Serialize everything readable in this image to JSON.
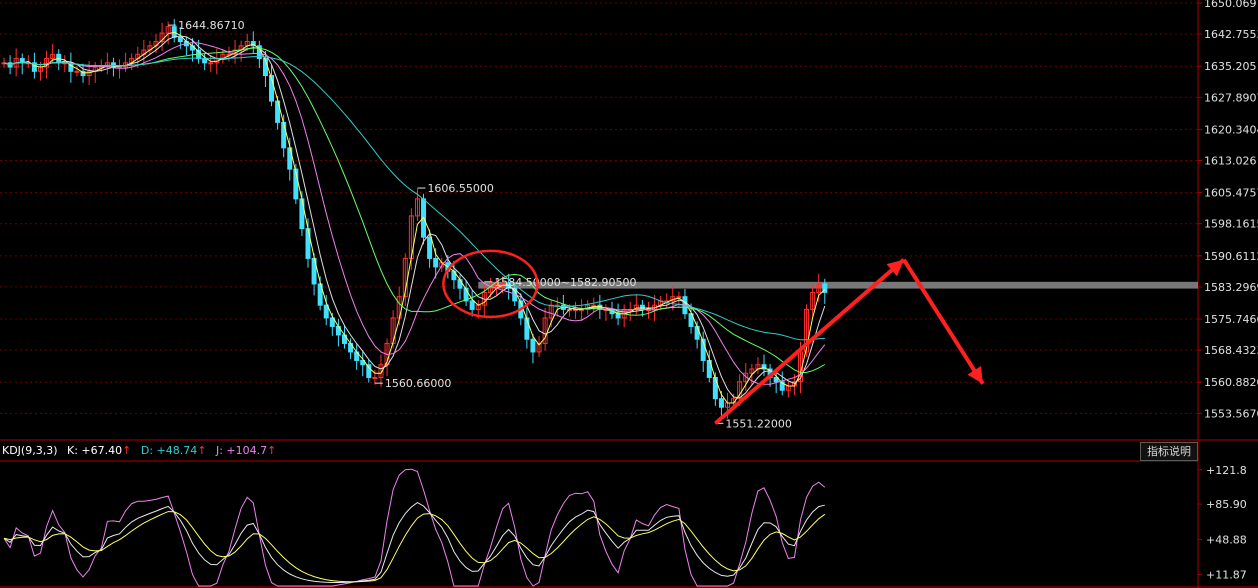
{
  "chart_data": [
    {
      "type": "line",
      "subtype": "candlestick-with-moving-averages",
      "ylim": [
        1548,
        1650.069
      ],
      "grid": true,
      "y_ticks": [
        {
          "label": "1650.069",
          "value": 1650.069
        },
        {
          "label": "1642.7553",
          "value": 1642.7553
        },
        {
          "label": "1635.205",
          "value": 1635.205
        },
        {
          "label": "1627.8907",
          "value": 1627.8907
        },
        {
          "label": "1620.3404",
          "value": 1620.3404
        },
        {
          "label": "1613.026",
          "value": 1613.026
        },
        {
          "label": "1605.4757",
          "value": 1605.4757
        },
        {
          "label": "1598.1615",
          "value": 1598.1615
        },
        {
          "label": "1590.6112",
          "value": 1590.6112
        },
        {
          "label": "1583.2969",
          "value": 1583.2969
        },
        {
          "label": "1575.7466",
          "value": 1575.7466
        },
        {
          "label": "1568.4323",
          "value": 1568.4323
        },
        {
          "label": "1560.8820",
          "value": 1560.882
        },
        {
          "label": "1553.5670",
          "value": 1553.567
        }
      ],
      "close_series": [
        1636,
        1635,
        1637,
        1636,
        1636,
        1634,
        1635,
        1637,
        1638,
        1636,
        1636,
        1634,
        1634,
        1633,
        1634,
        1635,
        1635,
        1636,
        1635,
        1635,
        1636,
        1637,
        1638,
        1639,
        1640,
        1641,
        1643,
        1644.5,
        1642,
        1641,
        1640,
        1639,
        1637,
        1636,
        1636,
        1637,
        1638,
        1638,
        1639,
        1640,
        1641,
        1640,
        1637,
        1633,
        1627,
        1622,
        1616,
        1611,
        1604,
        1597,
        1590,
        1584,
        1579,
        1576,
        1574,
        1572,
        1570,
        1568,
        1566,
        1565,
        1562,
        1562,
        1565,
        1570,
        1576,
        1581,
        1590,
        1600,
        1604,
        1595,
        1590,
        1588,
        1589,
        1587,
        1585,
        1583,
        1580,
        1578,
        1579,
        1582,
        1583,
        1584,
        1584,
        1583,
        1580,
        1576,
        1571,
        1568,
        1570,
        1576,
        1579,
        1579,
        1578,
        1578,
        1578,
        1578,
        1579,
        1579,
        1578,
        1578,
        1577,
        1576,
        1578,
        1578,
        1579,
        1578,
        1578,
        1579,
        1580,
        1580,
        1581,
        1581,
        1577,
        1574,
        1571,
        1566,
        1562,
        1557,
        1555,
        1556,
        1557,
        1561,
        1563,
        1564,
        1565,
        1564,
        1562,
        1561,
        1559,
        1560,
        1561,
        1568,
        1578,
        1582,
        1584,
        1582
      ],
      "ma_series": [
        {
          "color": "#ffff66",
          "window": 3
        },
        {
          "color": "#e0e0e0",
          "window": 5
        },
        {
          "color": "#ee82ee",
          "window": 10
        },
        {
          "color": "#66ff66",
          "window": 20
        },
        {
          "color": "#33cccc",
          "window": 40
        }
      ],
      "annotations": [
        {
          "text": "1644.86710",
          "x_index": 27,
          "value": 1644.8671
        },
        {
          "text": "1606.55000",
          "x_index": 68,
          "value": 1606.55
        },
        {
          "text": "1560.66000",
          "x_index": 61,
          "value": 1560.66
        },
        {
          "text": "1584.50000~1582.90500",
          "x_index": 79,
          "value": 1584.5
        },
        {
          "text": "1551.22000",
          "x_index": 117,
          "value": 1551.22
        }
      ],
      "resistance_band": {
        "from": 1582.905,
        "to": 1584.5,
        "color": "#8c8c8c"
      },
      "highlight_circle": {
        "x_index": 80,
        "value": 1584.0,
        "color": "#ff2020"
      },
      "forecast_arrows": {
        "color": "#ff2020",
        "path": [
          {
            "x_index": 117,
            "value": 1551.2
          },
          {
            "x_index": 148,
            "value": 1589.7
          },
          {
            "x_index": 161,
            "value": 1560.5
          }
        ]
      }
    },
    {
      "type": "line",
      "subtype": "kdj-indicator",
      "label": "KDJ(9,3,3)",
      "ylim": [
        0,
        130
      ],
      "y_ticks": [
        {
          "label": "+121.8",
          "value": 121.8
        },
        {
          "label": "+85.90",
          "value": 85.9
        },
        {
          "label": "+48.88",
          "value": 48.88
        },
        {
          "label": "+11.87",
          "value": 11.87
        }
      ],
      "series": [
        {
          "name": "K",
          "color": "#e8e8e8",
          "last": "+67.40"
        },
        {
          "name": "D",
          "color": "#ffff66",
          "last": "+48.74"
        },
        {
          "name": "J",
          "color": "#ee82ee",
          "last": "+104.7"
        }
      ]
    }
  ],
  "indicator_panel": {
    "title": "KDJ(9,3,3)",
    "k_text": "K: +67.40",
    "d_text": "D: +48.74",
    "j_text": "J: +104.7",
    "arrow": "↑",
    "help_button": "指标说明"
  },
  "colors": {
    "background": "#000000",
    "axis": "#b00000",
    "grid": "#6a0000",
    "axis_text": "#e0e0e0",
    "up_candle": "#ff3030",
    "down_candle": "#40e0ff",
    "k_text": "#ffffff",
    "d_text": "#33cccc",
    "j_text": "#ee82ee",
    "arrow_up": "#ff3030"
  }
}
